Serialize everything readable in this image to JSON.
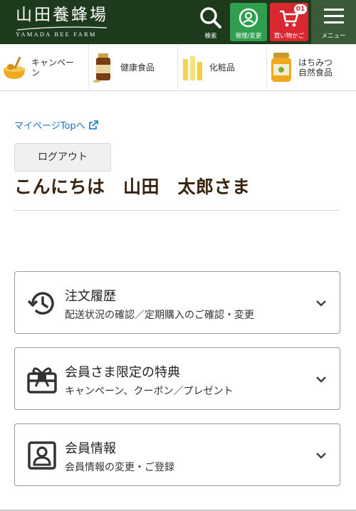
{
  "header": {
    "logo_jp": "山田養蜂場",
    "logo_en": "YAMADA BEE FARM",
    "search_label": "検索",
    "account_label": "管理/変更",
    "cart_label": "買い物かご",
    "cart_count": "01",
    "menu_label": "メニュー",
    "colors": {
      "bg": "#1d3a1c",
      "account": "#2f9e4f",
      "cart": "#d9282f"
    }
  },
  "categories": [
    {
      "label": "キャンペーン",
      "icon": "honey-dipper-icon"
    },
    {
      "label": "健康食品",
      "icon": "supplement-bottle-icon"
    },
    {
      "label": "化粧品",
      "icon": "cosmetics-icon"
    },
    {
      "label": "はちみつ\n自然食品",
      "icon": "honey-jar-icon"
    }
  ],
  "main": {
    "mypage_link": "マイページTopへ",
    "logout_label": "ログアウト",
    "greeting": "こんにちは　山田　太郎さま"
  },
  "cards": [
    {
      "title": "注文履歴",
      "subtitle": "配送状況の確認／定期購入のご確認・変更",
      "icon": "history-icon"
    },
    {
      "title": "会員さま限定の特典",
      "subtitle": "キャンペーン、クーポン／プレゼント",
      "icon": "gift-card-icon"
    },
    {
      "title": "会員情報",
      "subtitle": "会員情報の変更・ご登録",
      "icon": "member-profile-icon"
    }
  ]
}
